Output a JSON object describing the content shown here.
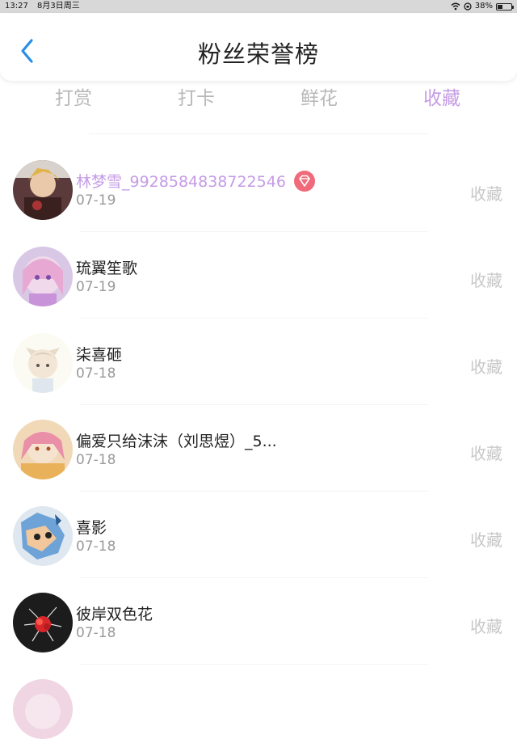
{
  "status_bar": {
    "time": "13:27",
    "date": "8月3日周三",
    "battery_percent": "38%"
  },
  "header": {
    "title": "粉丝荣誉榜"
  },
  "tabs": [
    {
      "label": "打赏",
      "active": false
    },
    {
      "label": "打卡",
      "active": false
    },
    {
      "label": "鲜花",
      "active": false
    },
    {
      "label": "收藏",
      "active": true
    }
  ],
  "colors": {
    "accent": "#c59be6",
    "badge": "#f06a7a",
    "back": "#2a8ee8"
  },
  "list": [
    {
      "name": "林梦雪_9928584838722546",
      "date": "07-19",
      "action": "收藏",
      "vip": true
    },
    {
      "name": "琉翼笙歌",
      "date": "07-19",
      "action": "收藏",
      "vip": false
    },
    {
      "name": "柒喜砸",
      "date": "07-18",
      "action": "收藏",
      "vip": false
    },
    {
      "name": "偏爱只给沫沫（刘思煜）_5...",
      "date": "07-18",
      "action": "收藏",
      "vip": false
    },
    {
      "name": "喜影",
      "date": "07-18",
      "action": "收藏",
      "vip": false
    },
    {
      "name": "彼岸双色花",
      "date": "07-18",
      "action": "收藏",
      "vip": false
    }
  ]
}
